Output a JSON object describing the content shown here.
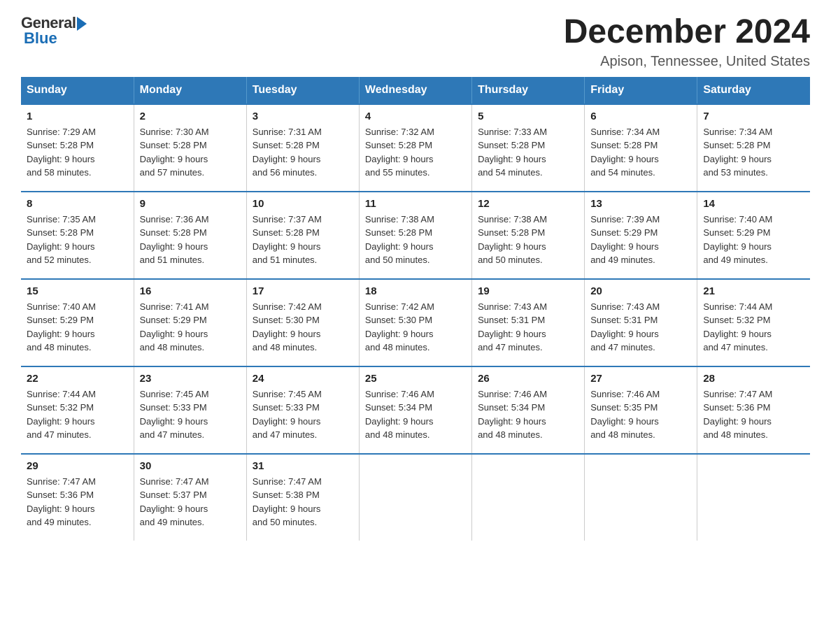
{
  "logo": {
    "general": "General",
    "blue": "Blue"
  },
  "header": {
    "month_title": "December 2024",
    "location": "Apison, Tennessee, United States"
  },
  "days_of_week": [
    "Sunday",
    "Monday",
    "Tuesday",
    "Wednesday",
    "Thursday",
    "Friday",
    "Saturday"
  ],
  "weeks": [
    [
      {
        "day": "1",
        "sunrise": "7:29 AM",
        "sunset": "5:28 PM",
        "daylight": "9 hours and 58 minutes."
      },
      {
        "day": "2",
        "sunrise": "7:30 AM",
        "sunset": "5:28 PM",
        "daylight": "9 hours and 57 minutes."
      },
      {
        "day": "3",
        "sunrise": "7:31 AM",
        "sunset": "5:28 PM",
        "daylight": "9 hours and 56 minutes."
      },
      {
        "day": "4",
        "sunrise": "7:32 AM",
        "sunset": "5:28 PM",
        "daylight": "9 hours and 55 minutes."
      },
      {
        "day": "5",
        "sunrise": "7:33 AM",
        "sunset": "5:28 PM",
        "daylight": "9 hours and 54 minutes."
      },
      {
        "day": "6",
        "sunrise": "7:34 AM",
        "sunset": "5:28 PM",
        "daylight": "9 hours and 54 minutes."
      },
      {
        "day": "7",
        "sunrise": "7:34 AM",
        "sunset": "5:28 PM",
        "daylight": "9 hours and 53 minutes."
      }
    ],
    [
      {
        "day": "8",
        "sunrise": "7:35 AM",
        "sunset": "5:28 PM",
        "daylight": "9 hours and 52 minutes."
      },
      {
        "day": "9",
        "sunrise": "7:36 AM",
        "sunset": "5:28 PM",
        "daylight": "9 hours and 51 minutes."
      },
      {
        "day": "10",
        "sunrise": "7:37 AM",
        "sunset": "5:28 PM",
        "daylight": "9 hours and 51 minutes."
      },
      {
        "day": "11",
        "sunrise": "7:38 AM",
        "sunset": "5:28 PM",
        "daylight": "9 hours and 50 minutes."
      },
      {
        "day": "12",
        "sunrise": "7:38 AM",
        "sunset": "5:28 PM",
        "daylight": "9 hours and 50 minutes."
      },
      {
        "day": "13",
        "sunrise": "7:39 AM",
        "sunset": "5:29 PM",
        "daylight": "9 hours and 49 minutes."
      },
      {
        "day": "14",
        "sunrise": "7:40 AM",
        "sunset": "5:29 PM",
        "daylight": "9 hours and 49 minutes."
      }
    ],
    [
      {
        "day": "15",
        "sunrise": "7:40 AM",
        "sunset": "5:29 PM",
        "daylight": "9 hours and 48 minutes."
      },
      {
        "day": "16",
        "sunrise": "7:41 AM",
        "sunset": "5:29 PM",
        "daylight": "9 hours and 48 minutes."
      },
      {
        "day": "17",
        "sunrise": "7:42 AM",
        "sunset": "5:30 PM",
        "daylight": "9 hours and 48 minutes."
      },
      {
        "day": "18",
        "sunrise": "7:42 AM",
        "sunset": "5:30 PM",
        "daylight": "9 hours and 48 minutes."
      },
      {
        "day": "19",
        "sunrise": "7:43 AM",
        "sunset": "5:31 PM",
        "daylight": "9 hours and 47 minutes."
      },
      {
        "day": "20",
        "sunrise": "7:43 AM",
        "sunset": "5:31 PM",
        "daylight": "9 hours and 47 minutes."
      },
      {
        "day": "21",
        "sunrise": "7:44 AM",
        "sunset": "5:32 PM",
        "daylight": "9 hours and 47 minutes."
      }
    ],
    [
      {
        "day": "22",
        "sunrise": "7:44 AM",
        "sunset": "5:32 PM",
        "daylight": "9 hours and 47 minutes."
      },
      {
        "day": "23",
        "sunrise": "7:45 AM",
        "sunset": "5:33 PM",
        "daylight": "9 hours and 47 minutes."
      },
      {
        "day": "24",
        "sunrise": "7:45 AM",
        "sunset": "5:33 PM",
        "daylight": "9 hours and 47 minutes."
      },
      {
        "day": "25",
        "sunrise": "7:46 AM",
        "sunset": "5:34 PM",
        "daylight": "9 hours and 48 minutes."
      },
      {
        "day": "26",
        "sunrise": "7:46 AM",
        "sunset": "5:34 PM",
        "daylight": "9 hours and 48 minutes."
      },
      {
        "day": "27",
        "sunrise": "7:46 AM",
        "sunset": "5:35 PM",
        "daylight": "9 hours and 48 minutes."
      },
      {
        "day": "28",
        "sunrise": "7:47 AM",
        "sunset": "5:36 PM",
        "daylight": "9 hours and 48 minutes."
      }
    ],
    [
      {
        "day": "29",
        "sunrise": "7:47 AM",
        "sunset": "5:36 PM",
        "daylight": "9 hours and 49 minutes."
      },
      {
        "day": "30",
        "sunrise": "7:47 AM",
        "sunset": "5:37 PM",
        "daylight": "9 hours and 49 minutes."
      },
      {
        "day": "31",
        "sunrise": "7:47 AM",
        "sunset": "5:38 PM",
        "daylight": "9 hours and 50 minutes."
      },
      null,
      null,
      null,
      null
    ]
  ]
}
